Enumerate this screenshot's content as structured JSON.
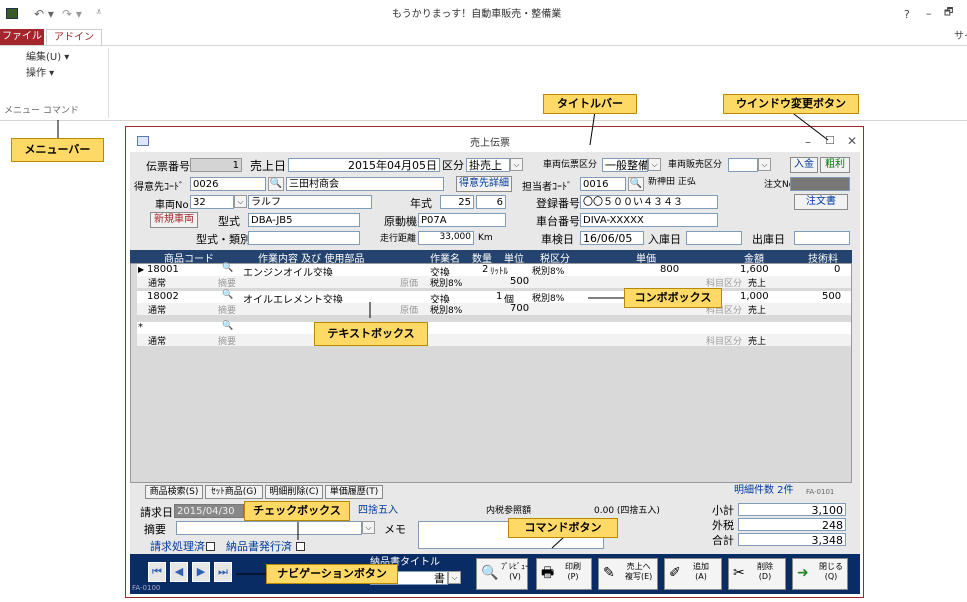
{
  "app": {
    "title": "もうかりまっす！自動車販売・整備業",
    "help": "?",
    "minimize": "–",
    "restore": "🗗",
    "sign": "サイ"
  },
  "ribbon": {
    "tabs": [
      "ファイル",
      "アドイン"
    ],
    "menu_items": [
      "編集(U) ▾",
      "操作 ▾"
    ],
    "group_label": "メニュー コマンド"
  },
  "window": {
    "title": "売上伝票",
    "minimize": "–",
    "maximize": "☐",
    "close": "✕"
  },
  "header": {
    "slip_no_label": "伝票番号",
    "slip_no": "1",
    "sale_date_label": "売上日",
    "sale_date": "2015年04月05日",
    "category_label": "区分",
    "category": "掛売上",
    "vehicle_slip_label": "車両伝票区分",
    "vehicle_slip": "一般整備",
    "vehicle_sales_label": "車両販売区分",
    "deposit_button": "入金",
    "gross_profit_button": "粗利",
    "customer_code_label": "得意先ｺｰﾄﾞ",
    "customer_code": "0026",
    "customer_name": "三田村商会",
    "customer_detail_button": "得意先詳細",
    "staff_code_label": "担当者ｺｰﾄﾞ",
    "staff_code": "0016",
    "staff_name": "新神田 正弘",
    "order_no_label": "注文No",
    "vehicle_no_label": "車両No",
    "vehicle_no": "32",
    "vehicle_name": "ラルフ",
    "year_label": "年式",
    "year": "25",
    "month": "6",
    "reg_no_label": "登録番号",
    "reg_no": "〇〇５００い４３４３",
    "order_button": "注文書",
    "new_vehicle_button": "新規車両",
    "model_label": "型式",
    "model": "DBA-JB5",
    "engine_label": "原動機",
    "engine": "P07A",
    "chassis_label": "車台番号",
    "chassis": "DIVA-XXXXX",
    "model_type_label": "型式・類別",
    "mileage_label": "走行距離",
    "mileage": "33,000",
    "mileage_unit": "Km",
    "inspection_label": "車検日",
    "inspection": "16/06/05",
    "entry_date_label": "入庫日",
    "exit_date_label": "出庫日"
  },
  "grid": {
    "headers": [
      "商品コード",
      "作業内容 及び 使用部品",
      "作業名",
      "数量",
      "単位",
      "税区分",
      "単価",
      "金額",
      "技術料"
    ],
    "row1": {
      "code": "18001",
      "name": "エンジンオイル交換",
      "work": "交換",
      "qty": "2",
      "unit": "ﾘｯﾄﾙ",
      "tax": "税別8%",
      "price": "800",
      "amount": "1,600",
      "tech": "0",
      "sub1": "通常",
      "sub2": "摘要",
      "cost_label": "原価",
      "cost_tax": "税別8%",
      "cost": "500",
      "cat_label": "科目区分",
      "cat": "売上"
    },
    "row2": {
      "code": "18002",
      "name": "オイルエレメント交換",
      "work": "交換",
      "qty": "1",
      "unit": "個",
      "tax": "税別8%",
      "amount": "1,000",
      "tech": "500",
      "sub1": "通常",
      "sub2": "摘要",
      "cost_label": "原価",
      "cost_tax": "税別8%",
      "cost": "700",
      "cat_label": "科目区分",
      "cat": "売上"
    },
    "row3": {
      "sub1": "通常",
      "sub2": "摘要",
      "cat_label": "科目区分",
      "cat": "売上"
    }
  },
  "footer_tabs": [
    "商品検索(S)",
    "ｾｯﾄ商品(G)",
    "明細削除(C)",
    "単価履歴(T)"
  ],
  "detail_count": "明細件数 2件",
  "form_id": "FA-0101",
  "footer": {
    "invoice_date_label": "請求日",
    "invoice_date": "2015/04/30",
    "rounding": "四捨五入",
    "tax_included_label": "内税参照額",
    "tax_included": "0.00 (四捨五入)",
    "subtotal_label": "小計",
    "subtotal": "3,100",
    "tax_label": "外税",
    "tax": "248",
    "total_label": "合計",
    "total": "3,348",
    "summary_label": "摘要",
    "memo_label": "メモ",
    "billing_done": "請求処理済",
    "delivery_done": "納品書発行済",
    "print_title_label": "納品書タイトル",
    "print_title": "書"
  },
  "commands": [
    "ﾌﾟﾚﾋﾞｭｰ\n(V)",
    "印刷\n(P)",
    "売上へ\n複写(E)",
    "追加\n(A)",
    "削除\n(D)",
    "閉じる\n(Q)"
  ],
  "nav_label": "FA-0100",
  "callouts": {
    "title_bar": "タイトルバー",
    "window_buttons": "ウインドウ変更ボタン",
    "menu_bar": "メニューバー",
    "combo_box": "コンボボックス",
    "text_box": "テキストボックス",
    "check_box": "チェックボックス",
    "command_button": "コマンドボタン",
    "nav_button": "ナビゲーションボタン"
  },
  "colors": {
    "accent_red": "#a4262c",
    "grid_header": "#24436e",
    "nav_bar": "#0a2c64",
    "callout": "#ffd966"
  }
}
